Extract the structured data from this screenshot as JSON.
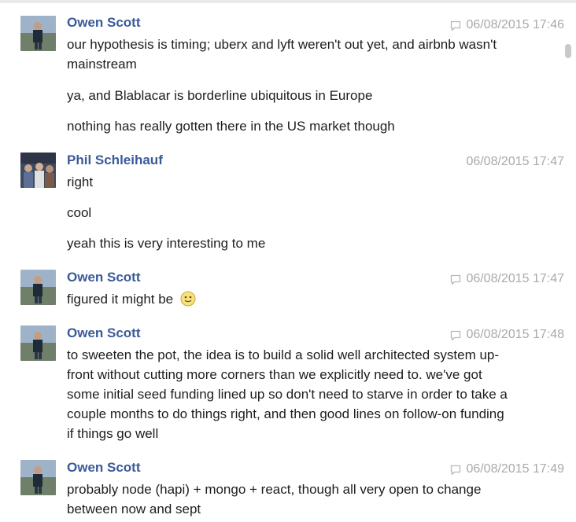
{
  "groups": [
    {
      "author": "Owen Scott",
      "timestamp": "06/08/2015 17:46",
      "lines": [
        "our hypothesis is timing; uberx and lyft weren't out yet, and airbnb wasn't mainstream",
        "ya, and Blablacar is borderline ubiquitous in Europe",
        "nothing has really gotten there in the US market though"
      ]
    },
    {
      "author": "Phil Schleihauf",
      "timestamp": "06/08/2015 17:47",
      "lines": [
        "right",
        "cool",
        "yeah this is very interesting to me"
      ]
    },
    {
      "author": "Owen Scott",
      "timestamp": "06/08/2015 17:47",
      "lines": [
        "figured it might be"
      ]
    },
    {
      "author": "Owen Scott",
      "timestamp": "06/08/2015 17:48",
      "lines": [
        "to sweeten the pot, the idea is to build a solid well architected system up-front without cutting more corners than we explicitly need to. we've got some initial seed funding lined up so don't need to starve in order to take a couple months to do things right, and then good lines on follow-on funding if things go well"
      ]
    },
    {
      "author": "Owen Scott",
      "timestamp": "06/08/2015 17:49",
      "lines": [
        "probably node (hapi) + mongo + react, though all very open to change between now and sept"
      ]
    }
  ],
  "colors": {
    "author": "#3b5a99",
    "timestamp": "#a9a9a9",
    "text": "#1d1d1d"
  },
  "icons": {
    "reply": "reply-icon",
    "emoji": "smiley-emoji"
  }
}
